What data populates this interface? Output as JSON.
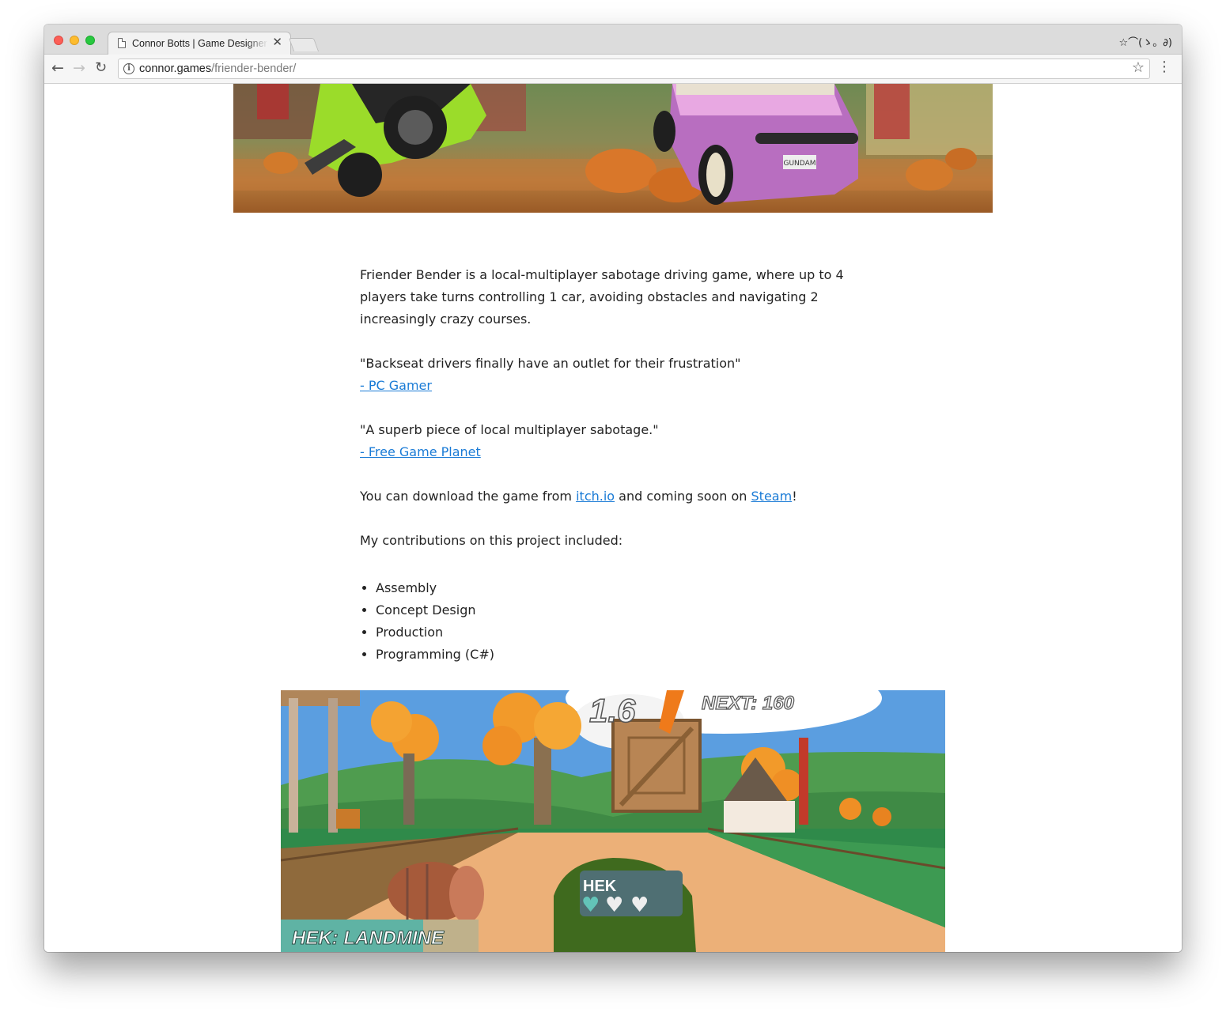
{
  "browser": {
    "tab_title": "Connor Botts | Game Designer",
    "tab_close": "✕",
    "profile_text": "☆⌒(ゝ。∂)",
    "url_domain": "connor.games",
    "url_path": "/friender-bender/",
    "info_glyph": "i",
    "star_glyph": "☆",
    "menu_glyph": "⋮",
    "back_glyph": "←",
    "forward_glyph": "→",
    "reload_glyph": "↻"
  },
  "article": {
    "intro": "Friender Bender is a local-multiplayer sabotage driving game, where up to 4 players take turns controlling 1 car, avoiding obstacles and navigating 2 increasingly crazy courses.",
    "quote1": "\"Backseat drivers finally have an outlet for their frustration\"",
    "quote1_source": "- PC Gamer",
    "quote2": "\"A superb piece of local multiplayer sabotage.\"",
    "quote2_source": "- Free Game Planet",
    "download_pre": "You can download the game from ",
    "download_link1": "itch.io",
    "download_mid": " and coming soon on ",
    "download_link2": "Steam",
    "download_post": "!",
    "contrib_heading": "My contributions on this project included:",
    "contributions": [
      "Assembly",
      "Concept Design",
      "Production",
      "Programming (C#)"
    ]
  },
  "game_screenshot": {
    "score": "1.6",
    "next_label": "NEXT: 160",
    "player_tag": "HEK",
    "event_text": "HEK: LANDMINE",
    "license_plate": "GUNDAM"
  },
  "colors": {
    "link": "#1a7bd6",
    "text": "#222222",
    "sky": "#5b9ee0"
  }
}
